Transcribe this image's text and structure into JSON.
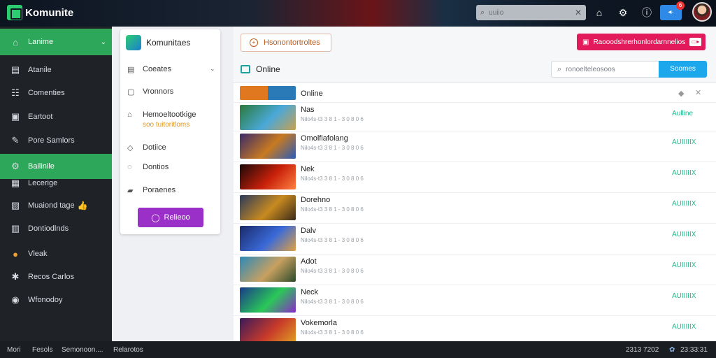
{
  "app": {
    "title": "Komunite",
    "search_placeholder": "uuiio"
  },
  "topbar": {
    "icons": [
      "bag-icon",
      "gear-icon",
      "info-icon"
    ],
    "action_label": "◂·",
    "badge": "6"
  },
  "sidebar": {
    "items": [
      {
        "label": "Lanime",
        "icon": "home-icon",
        "active": true,
        "chevron": "⌄"
      },
      {
        "label": "Atanile",
        "icon": "chart-icon"
      },
      {
        "label": "Comenties",
        "icon": "grid-icon"
      },
      {
        "label": "Eartoot",
        "icon": "box-icon"
      },
      {
        "label": "Pore Samlors",
        "icon": "brush-icon"
      },
      {
        "label": "Bailinile",
        "icon": "gear-icon",
        "active": true
      },
      {
        "label": "Lecerige",
        "icon": "gift-icon"
      },
      {
        "label": "Muaiond tage",
        "icon": "image-icon",
        "extra": "👍"
      },
      {
        "label": "Dontiodlnds",
        "icon": "bank-icon"
      },
      {
        "label": "Vleak",
        "icon": "coin-icon"
      },
      {
        "label": "Recos Carlos",
        "icon": "puzzle-icon"
      },
      {
        "label": "Wfonodoy",
        "icon": "globe-icon"
      }
    ]
  },
  "panel": {
    "title": "Komunitaes",
    "items": [
      {
        "label": "Coeates",
        "icon": "chart-icon",
        "chevron": "⌄"
      },
      {
        "label": "Vronnors",
        "icon": "tray-icon"
      },
      {
        "label": "Hemoeltootkige",
        "sub": "soo tuitoritloms",
        "icon": "home-icon"
      },
      {
        "label": "Dotiice",
        "icon": "shield-icon"
      },
      {
        "label": "Dontios",
        "icon": "pin-icon"
      },
      {
        "label": "Poraenes",
        "icon": "bag-icon"
      }
    ],
    "button_label": "Relieoo"
  },
  "main": {
    "top_button": "Hsonontortroltes",
    "pink_button": "Raooodshrerhonlordarnnelios",
    "pink_button_tail": "▭▸",
    "list_title": "Online",
    "search_placeholder": "ronoelteleosoos",
    "search_button": "Soomes",
    "header_row": {
      "name": "Online"
    },
    "rows": [
      {
        "name": "Nas",
        "meta": "Nilo4s-t3 3 8 1 - 3 0 8 0 6",
        "status": "Aulline",
        "colors": [
          "#2a7a3a",
          "#4aa8d8",
          "#c8a050"
        ]
      },
      {
        "name": "Omolfiafolang",
        "meta": "Nilo4s-t3 3 8 1 - 3 0 8 0 6",
        "status": "AUIIIIIX",
        "colors": [
          "#3a2a6a",
          "#c87a20",
          "#2a5ab8"
        ]
      },
      {
        "name": "Nek",
        "meta": "Nilo4s-t3 3 8 1 - 3 0 8 0 6",
        "status": "AUIIIIIX",
        "colors": [
          "#1a0808",
          "#c8200a",
          "#ff8040"
        ]
      },
      {
        "name": "Dorehno",
        "meta": "Nilo4s-t3 3 8 1 - 3 0 8 0 6",
        "status": "AUIIIIIX",
        "colors": [
          "#2a3a5a",
          "#c88a20",
          "#3a2a1a"
        ]
      },
      {
        "name": "Dalv",
        "meta": "Nilo4s-t3 3 8 1 - 3 0 8 0 6",
        "status": "AUIIIIIX",
        "colors": [
          "#1a2a6a",
          "#3a6ad8",
          "#e0a040"
        ]
      },
      {
        "name": "Adot",
        "meta": "Nilo4s-t3 3 8 1 - 3 0 8 0 6",
        "status": "AUIIIIIX",
        "colors": [
          "#2a8ab8",
          "#c8a060",
          "#2a4a2a"
        ]
      },
      {
        "name": "Neck",
        "meta": "Nilo4s-t3 3 8 1 - 3 0 8 0 6",
        "status": "AUIIIIIX",
        "colors": [
          "#1a3a8a",
          "#2ac858",
          "#8a2ac8"
        ]
      },
      {
        "name": "Vokemorla",
        "meta": "Nilo4s-t3 3 8 1 - 3 0 8 0 6",
        "status": "AUIIIIIX",
        "colors": [
          "#3a1a5a",
          "#c83a2a",
          "#e0a020"
        ]
      }
    ]
  },
  "bottombar": {
    "left": [
      "Mori",
      "Fesols",
      "Semonoon....",
      "Relarotos"
    ],
    "right_date": "2313 7202",
    "right_time": "23:33:31"
  }
}
